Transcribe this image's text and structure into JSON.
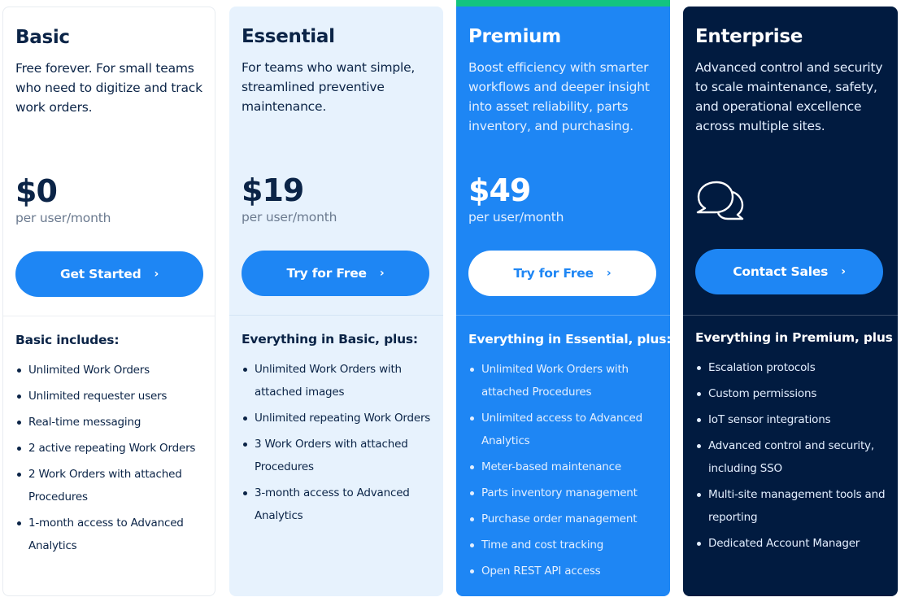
{
  "colors": {
    "brand_blue": "#1e86f4",
    "navy": "#011b40",
    "essential_bg": "#e7f2fd",
    "premium_highlight_band": "#13c47f",
    "text_dark": "#0b2447"
  },
  "plans": [
    {
      "name": "Basic",
      "description": "Free forever. For small teams who need to digitize and track work orders.",
      "price": "$0",
      "price_unit": "per user/month",
      "cta_label": "Get Started",
      "cta_icon": "chevron-right-icon",
      "includes_title": "Basic includes:",
      "features": [
        "Unlimited Work Orders",
        "Unlimited requester users",
        "Real-time messaging",
        "2 active repeating Work Orders",
        "2 Work Orders with attached Procedures",
        "1-month access to Advanced Analytics"
      ]
    },
    {
      "name": "Essential",
      "description": "For teams who want simple, streamlined preventive maintenance.",
      "price": "$19",
      "price_unit": "per user/month",
      "cta_label": "Try for Free",
      "cta_icon": "chevron-right-icon",
      "includes_title": "Everything in Basic, plus:",
      "features": [
        "Unlimited Work Orders with attached images",
        "Unlimited repeating Work Orders",
        "3 Work Orders with attached Procedures",
        "3-month access to Advanced Analytics"
      ]
    },
    {
      "name": "Premium",
      "highlighted": true,
      "description": "Boost efficiency with smarter workflows and deeper insight into asset reliability, parts inventory, and purchasing.",
      "price": "$49",
      "price_unit": "per user/month",
      "cta_label": "Try for Free",
      "cta_icon": "chevron-right-icon",
      "includes_title": "Everything in Essential, plus:",
      "features": [
        "Unlimited Work Orders with attached Procedures",
        "Unlimited access to Advanced Analytics",
        "Meter-based maintenance",
        "Parts inventory management",
        "Purchase order management",
        "Time and cost tracking",
        "Open REST API access"
      ]
    },
    {
      "name": "Enterprise",
      "description": "Advanced control and security to scale maintenance, safety, and operational excellence across multiple sites.",
      "price_icon": "chat-bubbles-icon",
      "cta_label": "Contact Sales",
      "cta_icon": "chevron-right-icon",
      "includes_title": "Everything in Premium, plus",
      "features": [
        "Escalation protocols",
        "Custom permissions",
        "IoT sensor integrations",
        "Advanced control and security, including SSO",
        "Multi-site management tools and reporting",
        "Dedicated Account Manager"
      ]
    }
  ]
}
